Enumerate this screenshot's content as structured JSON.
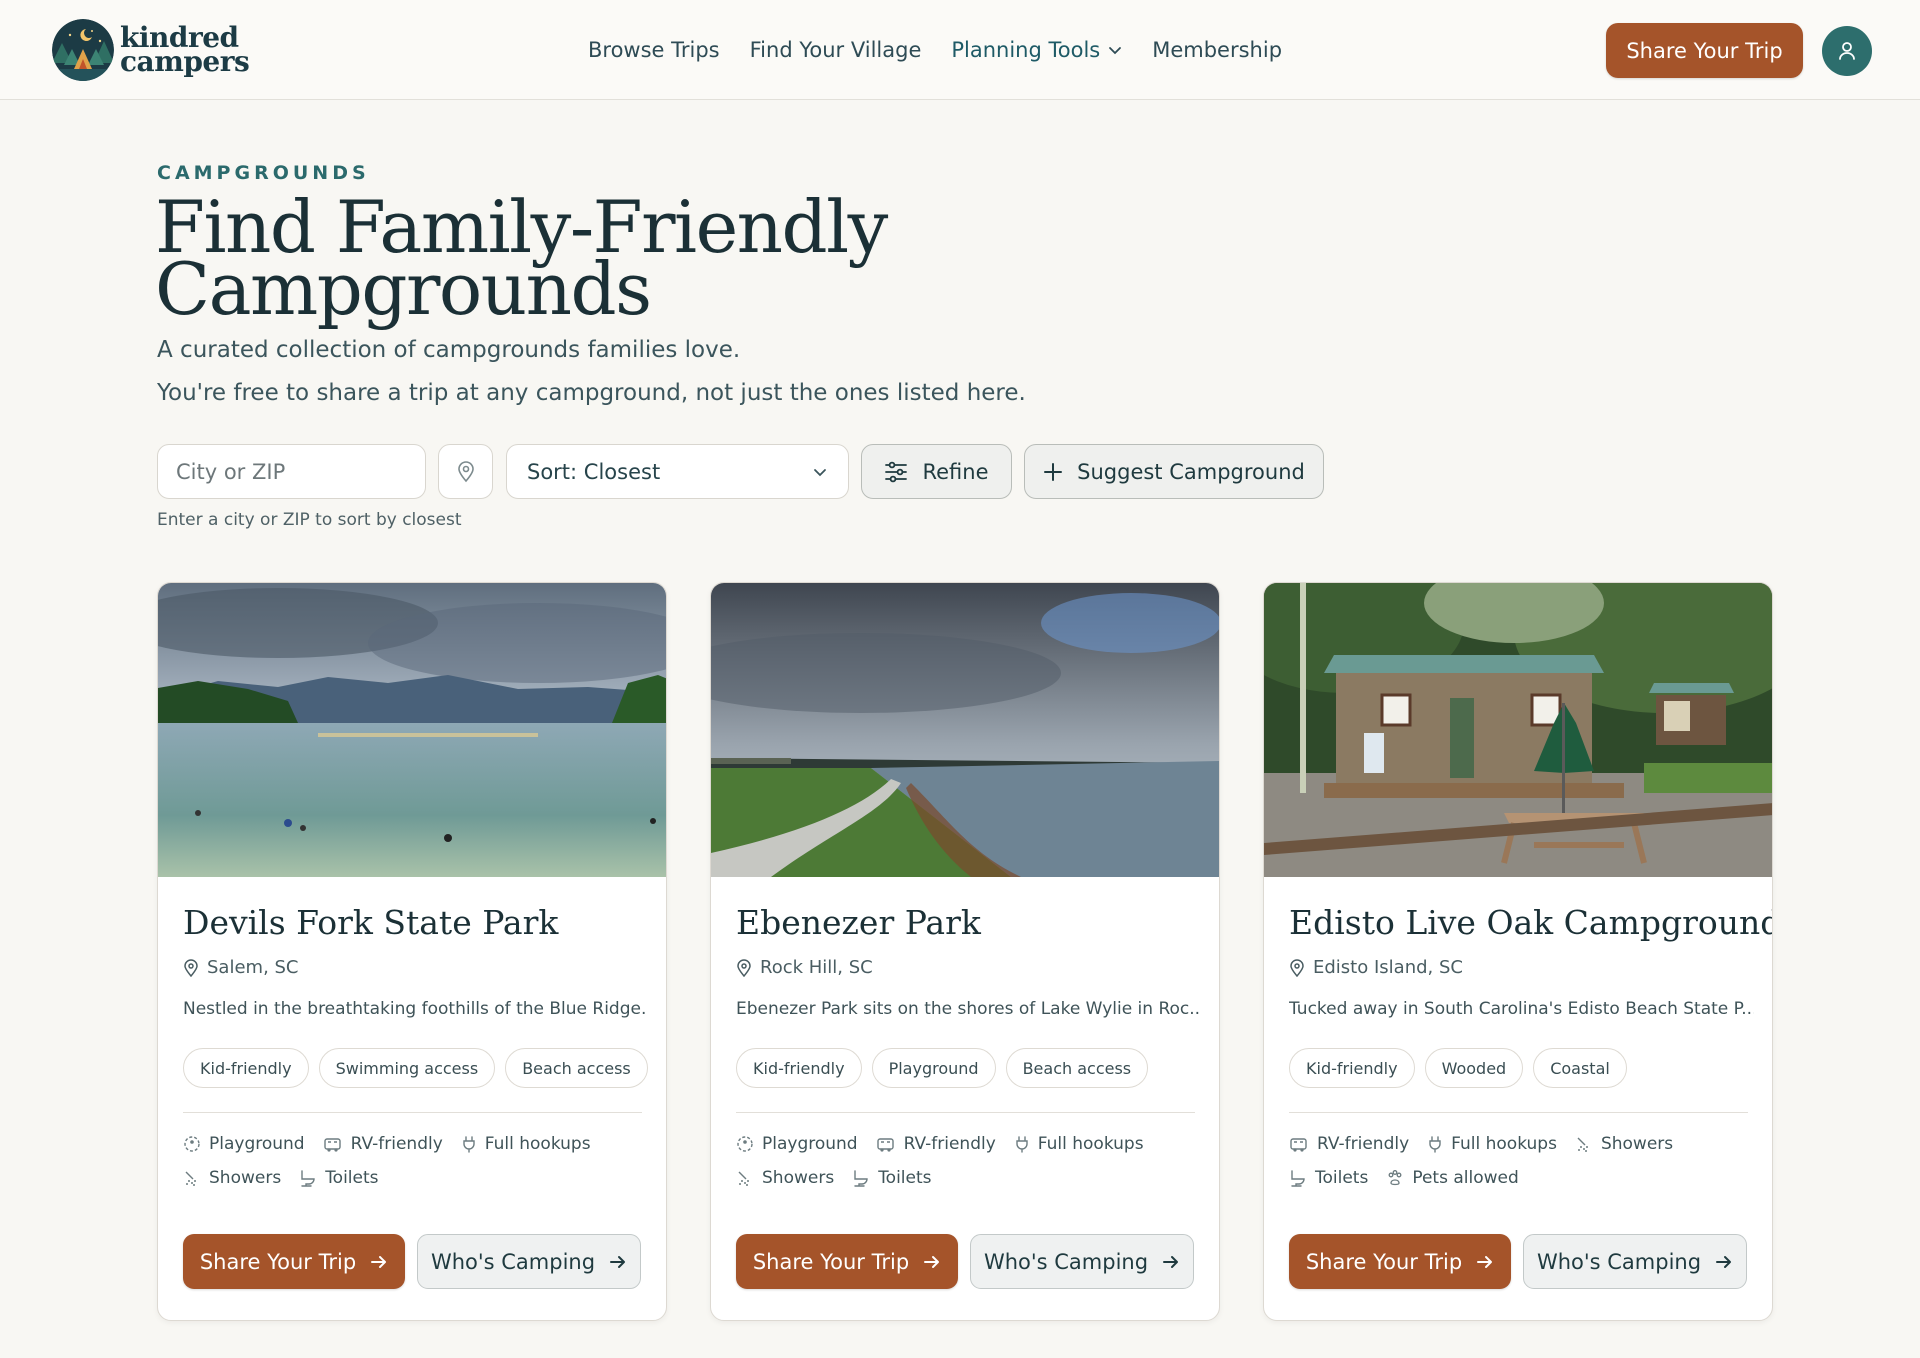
{
  "brand": {
    "name_line1": "kindred",
    "name_line2": "campers"
  },
  "nav": {
    "items": [
      "Browse Trips",
      "Find Your Village",
      "Planning Tools",
      "Membership"
    ],
    "cta": "Share Your Trip"
  },
  "hero": {
    "eyebrow": "CAMPGROUNDS",
    "title_line1": "Find Family-Friendly",
    "title_line2": "Campgrounds",
    "subtitle1": "A curated collection of campgrounds families love.",
    "subtitle2": "You're free to share a trip at any campground, not just the ones listed here."
  },
  "filters": {
    "city_placeholder": "City or ZIP",
    "sort_label": "Sort: Closest",
    "refine_label": "Refine",
    "suggest_label": "Suggest Campground",
    "hint": "Enter a city or ZIP to sort by closest"
  },
  "icons": {
    "nav_chevron": "chevron-down-icon",
    "avatar": "user-icon",
    "location": "map-pin-icon",
    "sort_chevron": "chevron-down-icon",
    "refine": "sliders-icon",
    "suggest": "plus-icon",
    "arrow": "arrow-right-icon"
  },
  "cards": [
    {
      "title": "Devils Fork State Park",
      "location": "Salem, SC",
      "description": "Nestled in the breathtaking foothills of the Blue Ridge...",
      "tags": [
        "Kid-friendly",
        "Swimming access",
        "Beach access"
      ],
      "amenities_row1": [
        "Playground",
        "RV-friendly",
        "Full hookups"
      ],
      "amenities_row2": [
        "Showers",
        "Toilets"
      ],
      "share_label": "Share Your Trip",
      "who_label": "Who's Camping"
    },
    {
      "title": "Ebenezer Park",
      "location": "Rock Hill, SC",
      "description": "Ebenezer Park sits on the shores of Lake Wylie in Roc...",
      "tags": [
        "Kid-friendly",
        "Playground",
        "Beach access"
      ],
      "amenities_row1": [
        "Playground",
        "RV-friendly",
        "Full hookups"
      ],
      "amenities_row2": [
        "Showers",
        "Toilets"
      ],
      "share_label": "Share Your Trip",
      "who_label": "Who's Camping"
    },
    {
      "title": "Edisto Live Oak Campground",
      "location": "Edisto Island, SC",
      "description": "Tucked away in South Carolina's Edisto Beach State P...",
      "tags": [
        "Kid-friendly",
        "Wooded",
        "Coastal"
      ],
      "amenities_row1": [
        "RV-friendly",
        "Full hookups",
        "Showers"
      ],
      "amenities_row2": [
        "Toilets",
        "Pets allowed"
      ],
      "share_label": "Share Your Trip",
      "who_label": "Who's Camping"
    }
  ],
  "colors": {
    "accent": "#a5542a",
    "teal": "#2d6e6d",
    "ink": "#1b3036",
    "background": "#f8f7f3"
  }
}
